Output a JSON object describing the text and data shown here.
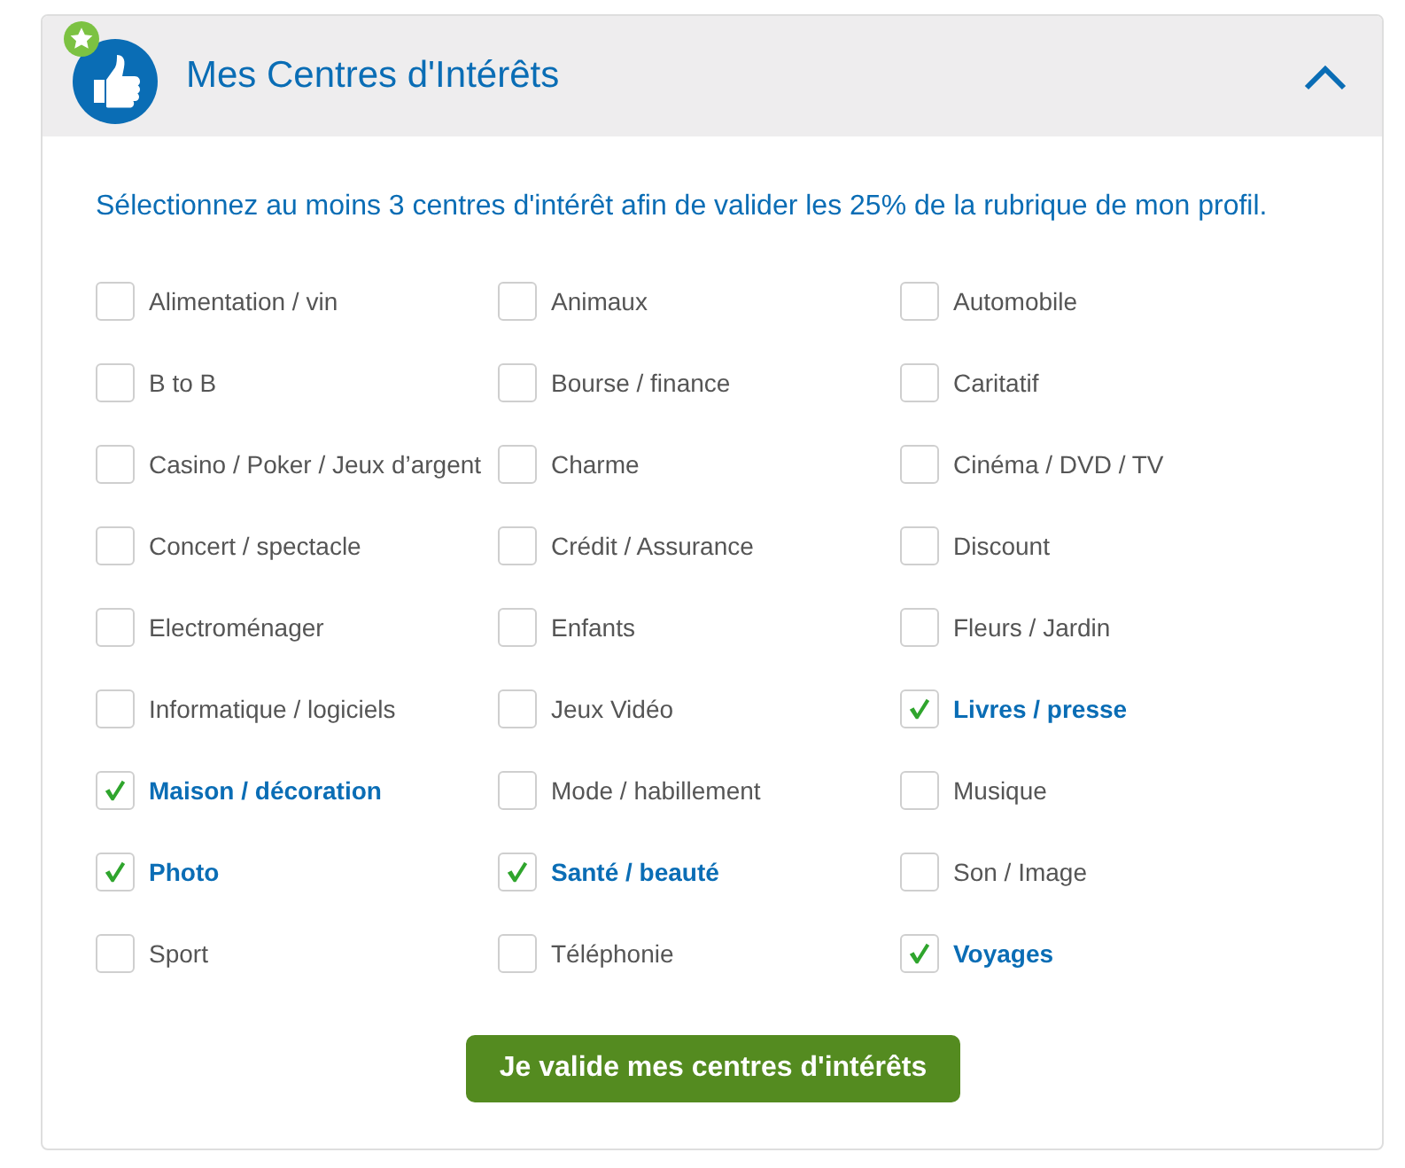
{
  "panel": {
    "title": "Mes Centres d'Intérêts",
    "expanded": true
  },
  "intro": "Sélectionnez au moins 3 centres d'intérêt afin de valider les 25% de la rubrique de mon profil.",
  "interests": [
    {
      "label": "Alimentation / vin",
      "checked": false
    },
    {
      "label": "Animaux",
      "checked": false
    },
    {
      "label": "Automobile",
      "checked": false
    },
    {
      "label": "B to B",
      "checked": false
    },
    {
      "label": "Bourse / finance",
      "checked": false
    },
    {
      "label": "Caritatif",
      "checked": false
    },
    {
      "label": "Casino / Poker / Jeux d’argent",
      "checked": false
    },
    {
      "label": "Charme",
      "checked": false
    },
    {
      "label": "Cinéma / DVD / TV",
      "checked": false
    },
    {
      "label": "Concert / spectacle",
      "checked": false
    },
    {
      "label": "Crédit / Assurance",
      "checked": false
    },
    {
      "label": "Discount",
      "checked": false
    },
    {
      "label": "Electroménager",
      "checked": false
    },
    {
      "label": "Enfants",
      "checked": false
    },
    {
      "label": "Fleurs / Jardin",
      "checked": false
    },
    {
      "label": "Informatique / logiciels",
      "checked": false
    },
    {
      "label": "Jeux Vidéo",
      "checked": false
    },
    {
      "label": "Livres / presse",
      "checked": true
    },
    {
      "label": "Maison / décoration",
      "checked": true
    },
    {
      "label": "Mode / habillement",
      "checked": false
    },
    {
      "label": "Musique",
      "checked": false
    },
    {
      "label": "Photo",
      "checked": true
    },
    {
      "label": "Santé / beauté",
      "checked": true
    },
    {
      "label": "Son / Image",
      "checked": false
    },
    {
      "label": "Sport",
      "checked": false
    },
    {
      "label": "Téléphonie",
      "checked": false
    },
    {
      "label": "Voyages",
      "checked": true
    }
  ],
  "submit_button": "Je valide mes centres d'intérêts"
}
